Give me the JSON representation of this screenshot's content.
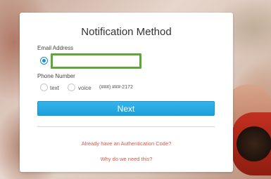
{
  "form": {
    "title": "Notification Method",
    "email_label": "Email Address",
    "email_value": "",
    "email_selected": true,
    "phone_label": "Phone Number",
    "phone_options": [
      {
        "label": "text",
        "selected": false
      },
      {
        "label": "voice",
        "selected": false
      }
    ],
    "phone_masked": "(###) ###-2172",
    "next_label": "Next",
    "auth_code_link": "Already have an Authentication Code?",
    "why_link": "Why do we need this?"
  },
  "colors": {
    "accent": "#1aa0dc",
    "focus_border": "#5ea53a",
    "link": "#e0553e"
  }
}
